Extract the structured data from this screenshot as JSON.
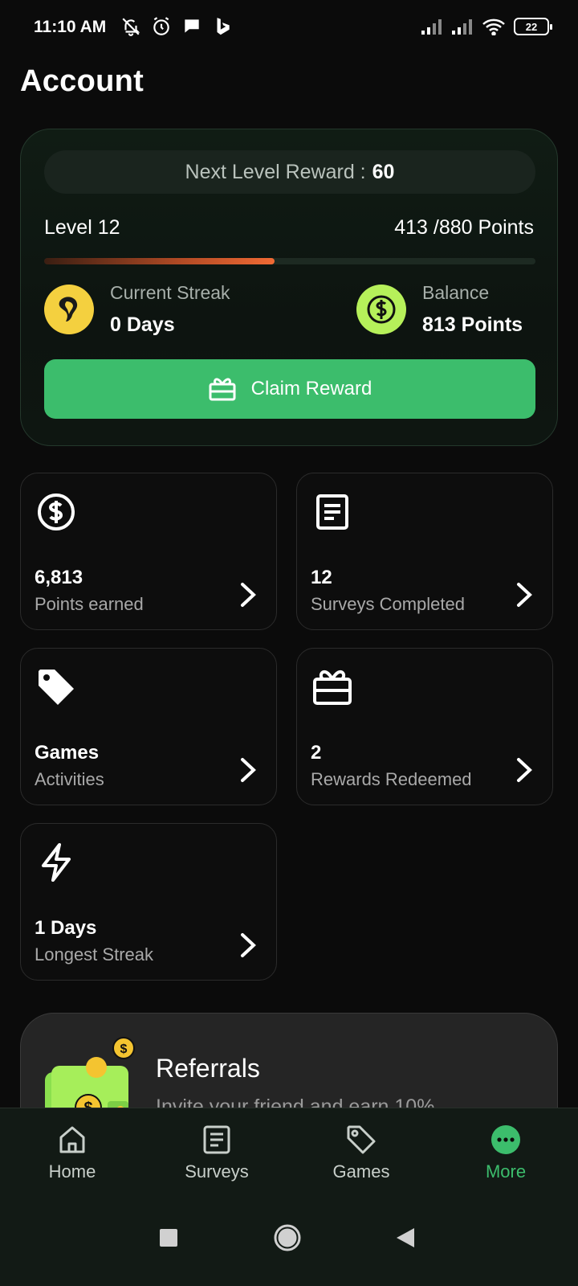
{
  "status_bar": {
    "time": "11:10 AM",
    "battery": "22"
  },
  "page": {
    "title": "Account"
  },
  "level_card": {
    "reward_label": "Next Level Reward :",
    "reward_value": "60",
    "level": "Level 12",
    "points": "413 /880 Points",
    "progress_fraction": 0.469,
    "streak_label": "Current Streak",
    "streak_value": "0 Days",
    "balance_label": "Balance",
    "balance_value": "813 Points",
    "claim_label": "Claim Reward"
  },
  "tiles": [
    {
      "value": "6,813",
      "label": "Points earned",
      "icon": "dollar-circle-icon"
    },
    {
      "value": "12",
      "label": "Surveys Completed",
      "icon": "document-icon"
    },
    {
      "value": "Games",
      "label": "Activities",
      "icon": "tag-icon"
    },
    {
      "value": "2",
      "label": "Rewards Redeemed",
      "icon": "gift-icon"
    },
    {
      "value": "1 Days",
      "label": "Longest Streak",
      "icon": "lightning-icon"
    }
  ],
  "referrals": {
    "title": "Referrals",
    "subtitle": "Invite your friend and earn 10%"
  },
  "bottom_nav": [
    {
      "label": "Home",
      "icon": "home-icon",
      "active": false
    },
    {
      "label": "Surveys",
      "icon": "document-icon",
      "active": false
    },
    {
      "label": "Games",
      "icon": "tag-icon",
      "active": false
    },
    {
      "label": "More",
      "icon": "more-icon",
      "active": true
    }
  ],
  "colors": {
    "accent": "#3cbd6c",
    "progress": "#f06a34",
    "streak_icon": "#f4d03f",
    "balance_icon": "#b6f05a"
  }
}
